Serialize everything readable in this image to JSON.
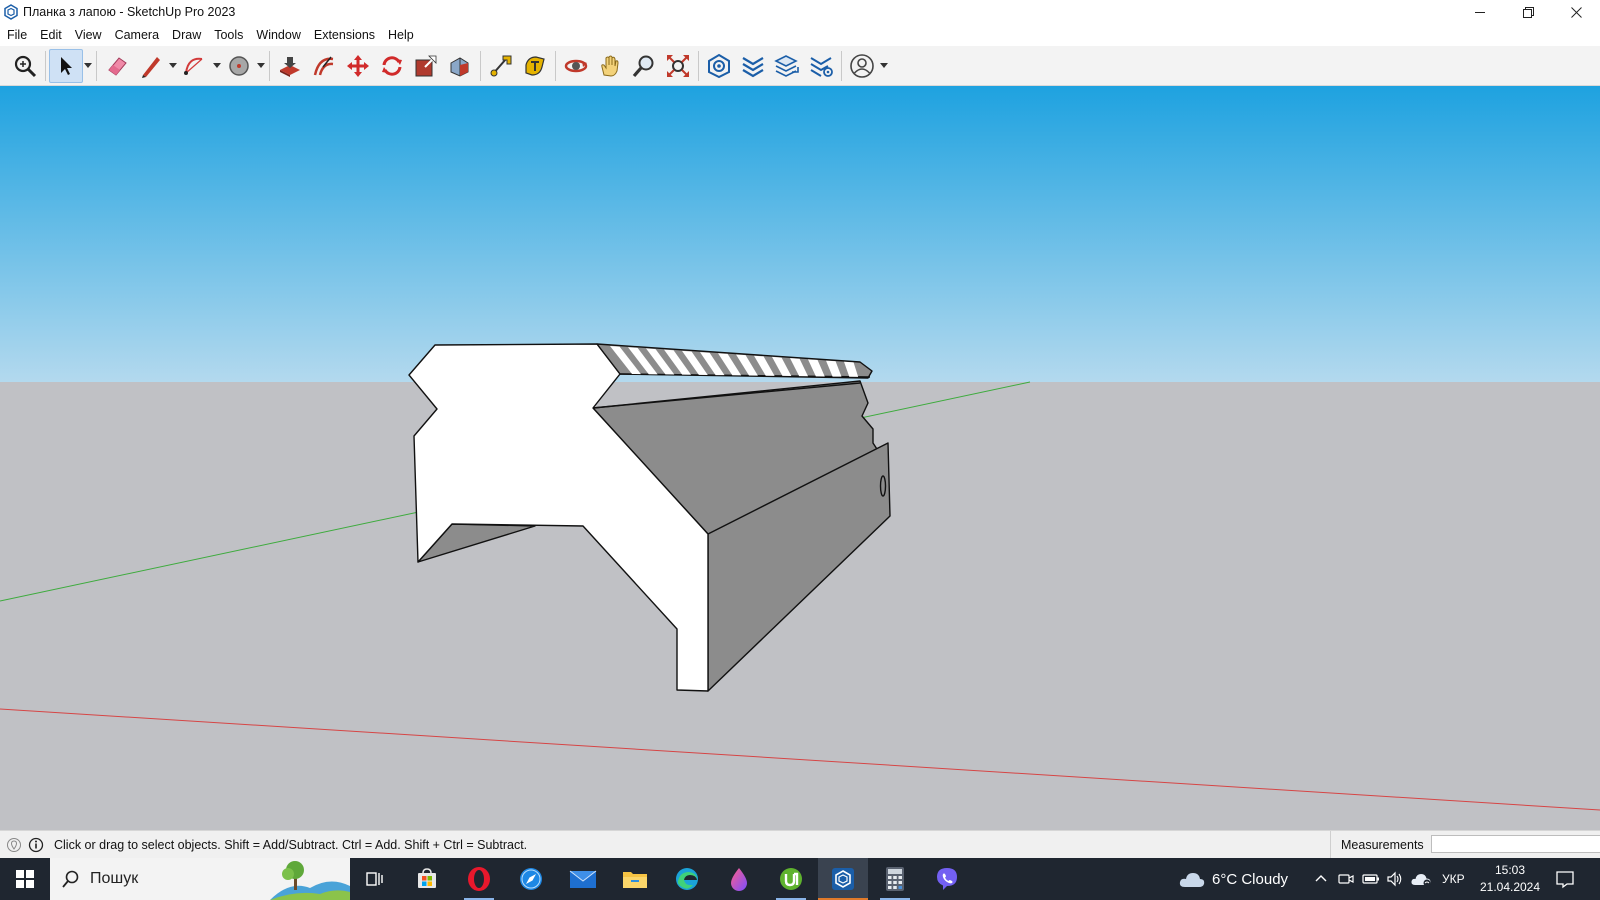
{
  "window": {
    "title": "Планка з лапою - SketchUp Pro 2023",
    "app_icon": "sketchup-icon",
    "controls": [
      "minimize-icon",
      "restore-icon",
      "close-icon"
    ]
  },
  "menu": [
    "File",
    "Edit",
    "View",
    "Camera",
    "Draw",
    "Tools",
    "Window",
    "Extensions",
    "Help"
  ],
  "toolbar": {
    "tools": [
      {
        "name": "search-tool-icon"
      },
      {
        "name": "select-tool-icon",
        "active": true
      },
      {
        "name": "eraser-tool-icon"
      },
      {
        "name": "line-tool-icon"
      },
      {
        "name": "arc-tool-icon"
      },
      {
        "name": "shapes-tool-icon"
      },
      {
        "name": "push-pull-tool-icon"
      },
      {
        "name": "offset-tool-icon"
      },
      {
        "name": "move-tool-icon"
      },
      {
        "name": "rotate-tool-icon"
      },
      {
        "name": "scale-tool-icon"
      },
      {
        "name": "paint-bucket-tool-icon"
      },
      {
        "name": "tape-measure-tool-icon"
      },
      {
        "name": "text-tool-icon"
      },
      {
        "name": "orbit-tool-icon"
      },
      {
        "name": "pan-tool-icon"
      },
      {
        "name": "zoom-tool-icon"
      },
      {
        "name": "zoom-extents-tool-icon"
      },
      {
        "name": "model-info-icon"
      },
      {
        "name": "tags-icon"
      },
      {
        "name": "layers-icon"
      },
      {
        "name": "scenes-icon"
      },
      {
        "name": "account-icon"
      }
    ]
  },
  "colors": {
    "sky_top": "#1ea2e0",
    "sky_bottom": "#b3d9ee",
    "ground": "#c0c1c5",
    "red_axis": "#d64545",
    "green_axis": "#3dab3d",
    "face_light": "#ffffff",
    "face_dark": "#8c8c8c"
  },
  "status": {
    "hint": "Click or drag to select objects. Shift = Add/Subtract. Ctrl = Add. Shift + Ctrl = Subtract.",
    "measurements_label": "Measurements",
    "measurements_value": ""
  },
  "taskbar": {
    "search_placeholder": "Пошук",
    "apps": [
      {
        "name": "task-view-icon"
      },
      {
        "name": "microsoft-store-icon"
      },
      {
        "name": "opera-icon"
      },
      {
        "name": "safari-like-browser-icon"
      },
      {
        "name": "mail-icon"
      },
      {
        "name": "file-explorer-icon"
      },
      {
        "name": "edge-icon"
      },
      {
        "name": "drop-app-icon"
      },
      {
        "name": "utorrent-icon"
      },
      {
        "name": "sketchup-taskbar-icon"
      },
      {
        "name": "calculator-icon"
      },
      {
        "name": "viber-icon"
      }
    ],
    "weather": "6°C  Cloudy",
    "language": "УКР",
    "time": "15:03",
    "date": "21.04.2024"
  }
}
